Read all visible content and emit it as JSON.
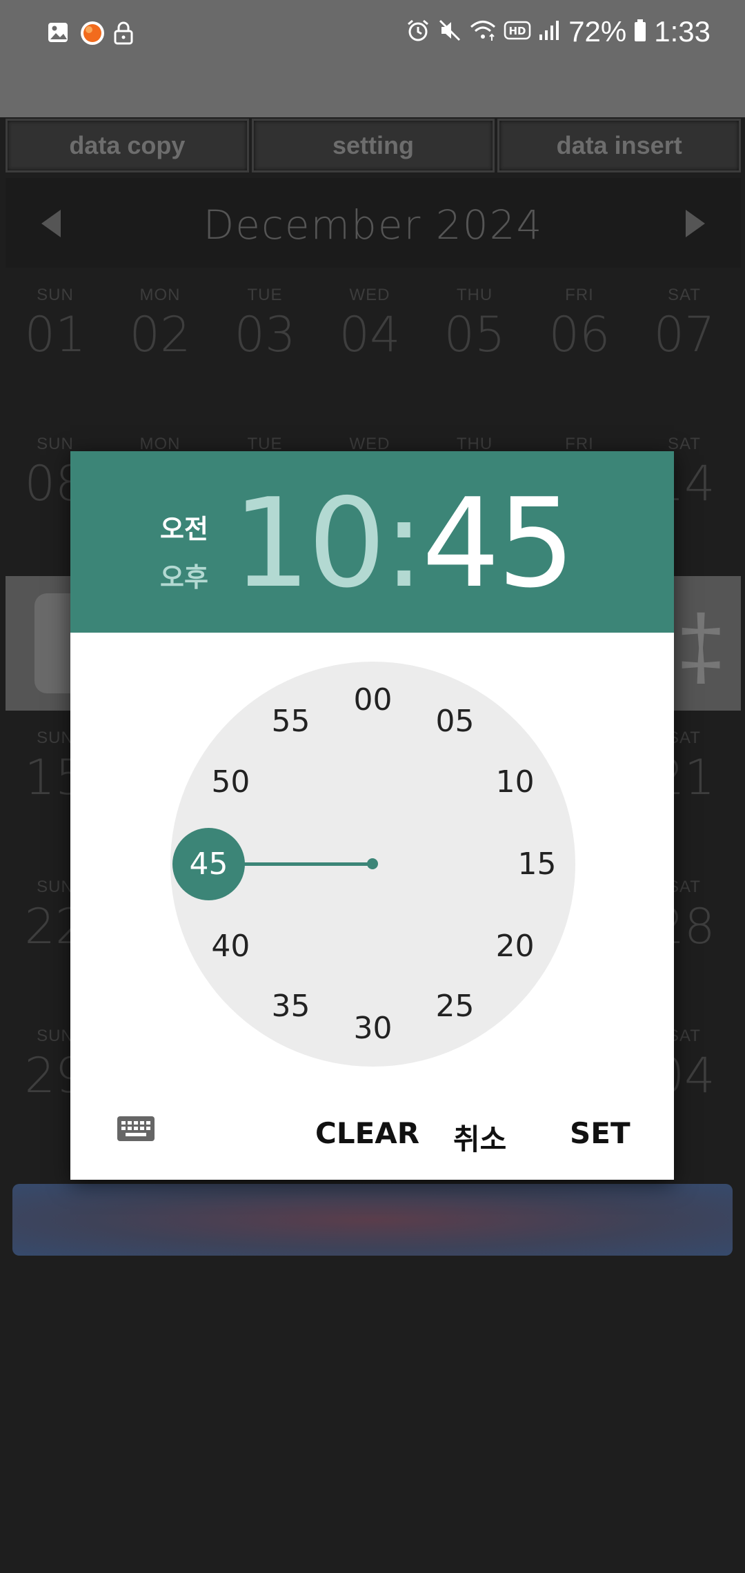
{
  "status_bar": {
    "left_icons": [
      "gallery-icon",
      "app-icon",
      "lock-icon"
    ],
    "right_icons": [
      "alarm-icon",
      "mute-icon",
      "wifi-icon",
      "hd-icon",
      "signal-icon"
    ],
    "battery": "72%",
    "time": "1:33"
  },
  "toolbar": {
    "data_copy": "data copy",
    "setting": "setting",
    "data_insert": "data insert"
  },
  "calendar": {
    "month_title": "December 2024",
    "week1": [
      {
        "dn": "SUN",
        "dd": "01"
      },
      {
        "dn": "MON",
        "dd": "02"
      },
      {
        "dn": "TUE",
        "dd": "03"
      },
      {
        "dn": "WED",
        "dd": "04"
      },
      {
        "dn": "THU",
        "dd": "05"
      },
      {
        "dn": "FRI",
        "dd": "06"
      },
      {
        "dn": "SAT",
        "dd": "07"
      }
    ],
    "week2_visible": {
      "sun_dn": "SUN",
      "sun_dd": "08",
      "mon_dn": "MON",
      "tue_dn": "TUE",
      "wed_dn": "WED",
      "thu_dn": "THU",
      "fri_dn": "FRI",
      "sat_dn": "SAT",
      "sat_dd": "14"
    },
    "week4_visible": {
      "sun_dn": "SUN",
      "sun_dd": "15",
      "sat_dn": "SAT",
      "sat_dd": "21"
    },
    "week5_visible": {
      "sun_dn": "SUN",
      "sun_dd": "22",
      "sat_dn": "SAT",
      "sat_dd": "28"
    },
    "week6_visible": {
      "sun_dn": "SUN",
      "sun_dd": "29",
      "sat_dn": "SAT",
      "sat_dd": "04"
    }
  },
  "time_picker": {
    "am_label": "오전",
    "pm_label": "오후",
    "hour": "10",
    "separator": ":",
    "minute": "45",
    "selected_minute": "45",
    "dial_numbers": [
      "00",
      "05",
      "10",
      "15",
      "20",
      "25",
      "30",
      "35",
      "40",
      "45",
      "50",
      "55"
    ],
    "clear_label": "CLEAR",
    "cancel_label": "취소",
    "set_label": "SET",
    "accent_color": "#3c8577"
  }
}
